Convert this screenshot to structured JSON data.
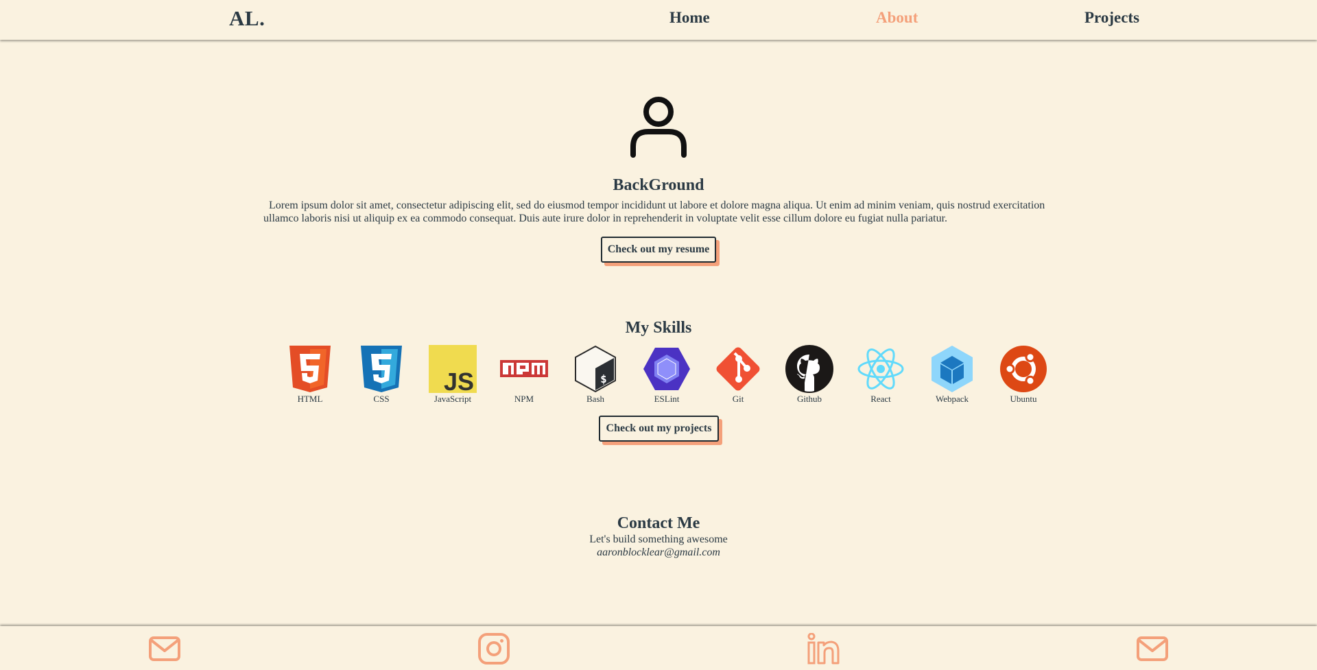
{
  "header": {
    "logo": "AL.",
    "nav": [
      {
        "label": "Home",
        "active": false
      },
      {
        "label": "About",
        "active": true
      },
      {
        "label": "Projects",
        "active": false
      }
    ]
  },
  "background": {
    "icon": "person-icon",
    "title": "BackGround",
    "text": "Lorem ipsum dolor sit amet, consectetur adipiscing elit, sed do eiusmod tempor incididunt ut labore et dolore magna aliqua. Ut enim ad minim veniam, quis nostrud exercitation ullamco laboris nisi ut aliquip ex ea commodo consequat. Duis aute irure dolor in reprehenderit in voluptate velit esse cillum dolore eu fugiat nulla pariatur.",
    "button_label": "Check out my resume"
  },
  "skills": {
    "title": "My Skills",
    "items": [
      {
        "label": "HTML",
        "icon": "html5-icon"
      },
      {
        "label": "CSS",
        "icon": "css3-icon"
      },
      {
        "label": "JavaScript",
        "icon": "javascript-icon"
      },
      {
        "label": "NPM",
        "icon": "npm-icon"
      },
      {
        "label": "Bash",
        "icon": "bash-icon"
      },
      {
        "label": "ESLint",
        "icon": "eslint-icon"
      },
      {
        "label": "Git",
        "icon": "git-icon"
      },
      {
        "label": "Github",
        "icon": "github-icon"
      },
      {
        "label": "React",
        "icon": "react-icon"
      },
      {
        "label": "Webpack",
        "icon": "webpack-icon"
      },
      {
        "label": "Ubuntu",
        "icon": "ubuntu-icon"
      }
    ],
    "button_label": "Check out my projects"
  },
  "contact": {
    "title": "Contact Me",
    "subtitle": "Let's build something awesome",
    "email": "aaronblocklear@gmail.com"
  },
  "footer": {
    "icons": [
      "mail-icon",
      "instagram-icon",
      "linkedin-icon",
      "mail-icon"
    ]
  },
  "colors": {
    "background": "#faf2e0",
    "text": "#2b3a44",
    "accent": "#f4a07a"
  }
}
